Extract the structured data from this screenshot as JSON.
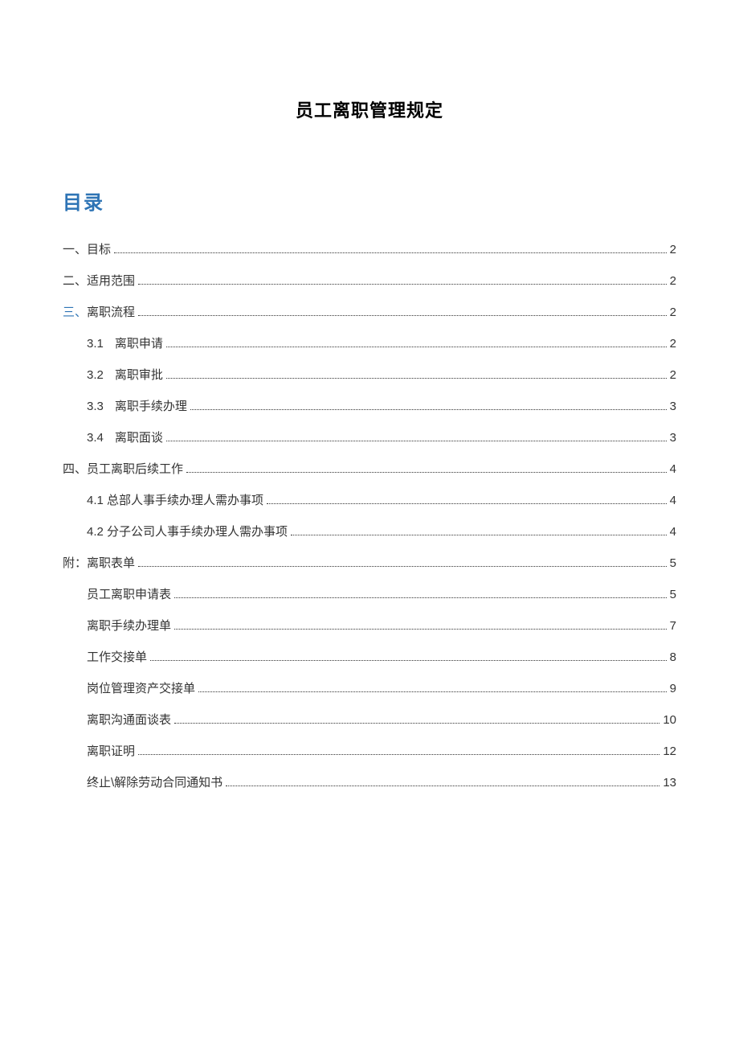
{
  "title": "员工离职管理规定",
  "toc_heading": "目录",
  "toc": {
    "e1": {
      "label": "一、目标",
      "page": "2"
    },
    "e2": {
      "label": "二、适用范围",
      "page": "2"
    },
    "e3": {
      "label_pre": "三、",
      "label": "离职流程",
      "page": "2"
    },
    "e3_1": {
      "num": "3.1",
      "label": "离职申请",
      "page": "2"
    },
    "e3_2": {
      "num": "3.2",
      "label": "离职审批",
      "page": "2"
    },
    "e3_3": {
      "num": "3.3",
      "label": "离职手续办理",
      "page": "3"
    },
    "e3_4": {
      "num": "3.4",
      "label": "离职面谈",
      "page": "3"
    },
    "e4": {
      "label": "四、员工离职后续工作",
      "page": "4"
    },
    "e4_1": {
      "label": "4.1 总部人事手续办理人需办事项",
      "page": "4"
    },
    "e4_2": {
      "label": "4.2 分子公司人事手续办理人需办事项",
      "page": "4"
    },
    "e5": {
      "label": "附：离职表单",
      "page": "5"
    },
    "e5_1": {
      "label": "员工离职申请表",
      "page": "5"
    },
    "e5_2": {
      "label": "离职手续办理单",
      "page": "7"
    },
    "e5_3": {
      "label": "工作交接单",
      "page": "8"
    },
    "e5_4": {
      "label": "岗位管理资产交接单",
      "page": "9"
    },
    "e5_5": {
      "label": "离职沟通面谈表",
      "page": "10"
    },
    "e5_6": {
      "label": "离职证明",
      "page": "12"
    },
    "e5_7": {
      "label": "终止\\解除劳动合同通知书",
      "page": "13"
    }
  }
}
